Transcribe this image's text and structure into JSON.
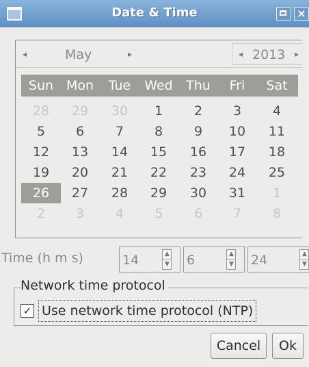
{
  "window": {
    "title": "Date & Time",
    "icons": [
      "app-icon",
      "maximize-icon",
      "close-icon"
    ],
    "close_glyph": "×"
  },
  "calendar": {
    "month": "May",
    "year": "2013",
    "prev_month_glyph": "◂",
    "next_month_glyph": "▸",
    "prev_year_glyph": "◂",
    "next_year_glyph": "▸",
    "day_names": [
      "Sun",
      "Mon",
      "Tue",
      "Wed",
      "Thu",
      "Fri",
      "Sat"
    ],
    "weeks": [
      [
        "28",
        "29",
        "30",
        "1",
        "2",
        "3",
        "4"
      ],
      [
        "5",
        "6",
        "7",
        "8",
        "9",
        "10",
        "11"
      ],
      [
        "12",
        "13",
        "14",
        "15",
        "16",
        "17",
        "18"
      ],
      [
        "19",
        "20",
        "21",
        "22",
        "23",
        "24",
        "25"
      ],
      [
        "26",
        "27",
        "28",
        "29",
        "30",
        "31",
        "1"
      ],
      [
        "2",
        "3",
        "4",
        "5",
        "6",
        "7",
        "8"
      ]
    ],
    "selected_day": "26",
    "colors": {
      "header_bg": "#9e9d9a",
      "selected_bg": "#9e9d9a",
      "dim_text": "#c8c7c4"
    }
  },
  "time": {
    "label": "Time (h m s)",
    "hours": "14",
    "minutes": "6",
    "seconds": "24"
  },
  "ntp": {
    "group_label": "Network time protocol",
    "checkbox_label": "Use network time protocol (NTP)",
    "checked": true,
    "check_glyph": "✓"
  },
  "buttons": {
    "cancel": "Cancel",
    "ok": "Ok"
  }
}
